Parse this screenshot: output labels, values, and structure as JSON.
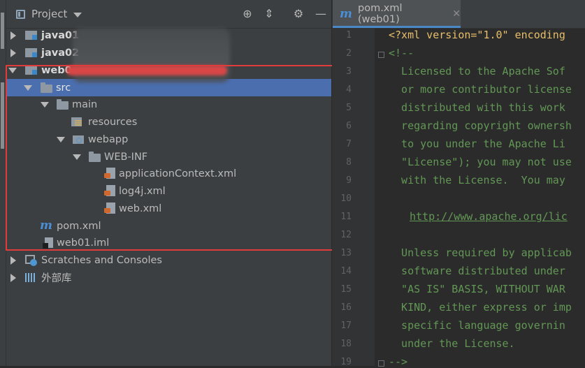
{
  "project_panel": {
    "title": "Project",
    "tree": [
      {
        "label": "java01",
        "bold": true,
        "type": "module"
      },
      {
        "label": "java02",
        "bold": true,
        "type": "module"
      },
      {
        "label": "web0",
        "bold": true,
        "type": "module"
      },
      {
        "label": "src",
        "type": "folder",
        "selected": true
      },
      {
        "label": "main",
        "type": "folder"
      },
      {
        "label": "resources",
        "type": "resources-folder"
      },
      {
        "label": "webapp",
        "type": "web-folder"
      },
      {
        "label": "WEB-INF",
        "type": "folder"
      },
      {
        "label": "applicationContext.xml",
        "type": "xml-file"
      },
      {
        "label": "log4j.xml",
        "type": "xml-file"
      },
      {
        "label": "web.xml",
        "type": "xml-file"
      },
      {
        "label": "pom.xml",
        "type": "maven-file"
      },
      {
        "label": "web01.iml",
        "type": "iml-file"
      },
      {
        "label": "Scratches and Consoles",
        "type": "scratches"
      },
      {
        "label": "外部库",
        "type": "libraries"
      }
    ]
  },
  "editor": {
    "tab_label": "pom.xml (web01)",
    "line_numbers": [
      "1",
      "2",
      "3",
      "4",
      "5",
      "6",
      "7",
      "8",
      "9",
      "10",
      "11",
      "12",
      "13",
      "14",
      "15",
      "16",
      "17",
      "18",
      "19"
    ],
    "lines": [
      "<?xml version=\"1.0\" encoding",
      "<!--",
      "  Licensed to the Apache Sof",
      "  or more contributor license",
      "  distributed with this work",
      "  regarding copyright ownersh",
      "  to you under the Apache Li",
      "  \"License\"); you may not use",
      "  with the License.  You may",
      "",
      "",
      "",
      "  Unless required by applicab",
      "  software distributed under",
      "  \"AS IS\" BASIS, WITHOUT WAR",
      "  KIND, either express or imp",
      "  specific language governin",
      "  under the License.",
      "-->"
    ],
    "url_line": "http://www.apache.org/lic"
  }
}
